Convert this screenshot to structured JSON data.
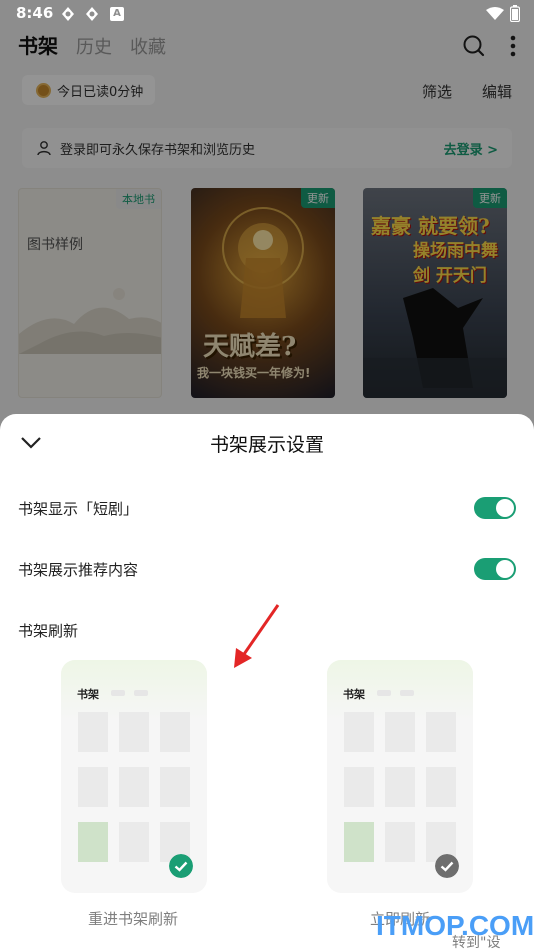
{
  "status": {
    "time": "8:46",
    "app_badge": "A"
  },
  "header": {
    "tabs": [
      {
        "label": "书架"
      },
      {
        "label": "历史"
      },
      {
        "label": "收藏"
      }
    ]
  },
  "reading": {
    "text": "今日已读0分钟"
  },
  "filters": {
    "filter": "筛选",
    "edit": "编辑"
  },
  "login_bar": {
    "text": "登录即可永久保存书架和浏览历史",
    "action": "去登录 >"
  },
  "books": [
    {
      "badge": "本地书",
      "title": "图书样例"
    },
    {
      "badge": "更新",
      "title_line1": "天赋差?",
      "title_line2": "我一块钱买一年修为!"
    },
    {
      "badge": "更新",
      "title_line1": "嘉豪 就要领?",
      "title_line2": "操场雨中舞剑 开天门"
    }
  ],
  "sheet": {
    "title": "书架展示设置",
    "rows": [
      {
        "label": "书架显示「短剧」",
        "on": true
      },
      {
        "label": "书架展示推荐内容",
        "on": true
      },
      {
        "label": "书架刷新"
      }
    ],
    "options": [
      {
        "mini_label": "书架",
        "caption": "重进书架刷新",
        "selected": true
      },
      {
        "mini_label": "书架",
        "caption": "立即刷新",
        "selected": false
      }
    ]
  },
  "watermark": {
    "text": "ITMOP.COM",
    "sub": "转到\"设置\"以"
  },
  "colors": {
    "accent": "#1a9e74",
    "dim": "rgba(0,0,0,0.42)"
  }
}
